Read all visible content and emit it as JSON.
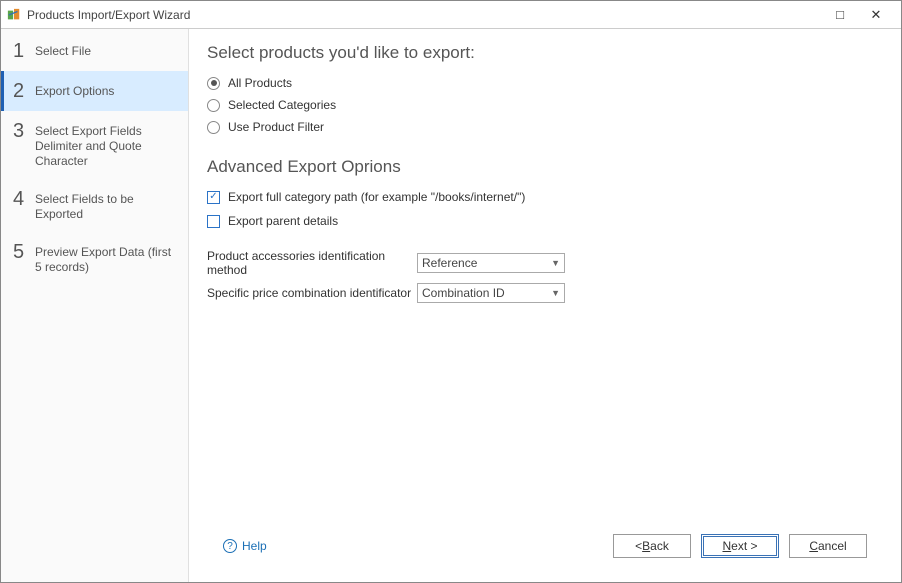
{
  "titlebar": {
    "title": "Products Import/Export Wizard"
  },
  "sidebar": {
    "steps": [
      {
        "num": "1",
        "label": "Select File"
      },
      {
        "num": "2",
        "label": "Export Options"
      },
      {
        "num": "3",
        "label": "Select Export Fields Delimiter and Quote Character"
      },
      {
        "num": "4",
        "label": "Select Fields to be Exported"
      },
      {
        "num": "5",
        "label": "Preview Export Data (first 5 records)"
      }
    ],
    "activeIndex": 1
  },
  "main": {
    "heading1": "Select products you'd like to export:",
    "radios": [
      {
        "label": "All Products",
        "selected": true
      },
      {
        "label": "Selected Categories",
        "selected": false
      },
      {
        "label": "Use Product Filter",
        "selected": false
      }
    ],
    "heading2": "Advanced Export Oprions",
    "checkboxes": [
      {
        "label": "Export full category path (for example \"/books/internet/\")",
        "checked": true
      },
      {
        "label": "Export parent details",
        "checked": false
      }
    ],
    "combos": [
      {
        "label": "Product accessories identification method",
        "value": "Reference"
      },
      {
        "label": "Specific price combination identificator",
        "value": "Combination ID"
      }
    ]
  },
  "footer": {
    "help": "Help",
    "back_prefix": "< ",
    "back_u": "B",
    "back_rest": "ack",
    "next_u": "N",
    "next_rest": "ext >",
    "cancel_u": "C",
    "cancel_rest": "ancel"
  }
}
